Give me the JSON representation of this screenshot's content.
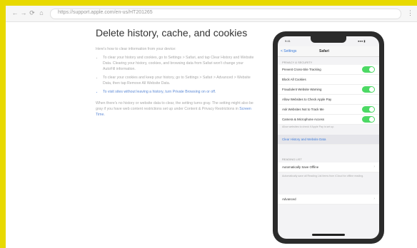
{
  "browser": {
    "back_glyph": "←",
    "forward_glyph": "→",
    "reload_glyph": "⟳",
    "home_glyph": "⌂",
    "url": "https://support.apple.com/en-us/HT201265",
    "menu_glyph": "⋮"
  },
  "article": {
    "title": "Delete history, cache, and cookies",
    "lead": "Here's how to clear information from your device:",
    "bullets": [
      "To clear your history and cookies, go to Settings > Safari, and tap Clear History and Website Data. Clearing your history, cookies, and browsing data from Safari won't change your AutoFill information.",
      "To clear your cookies and keep your history, go to Settings > Safari > Advanced > Website Data, then tap Remove All Website Data.",
      "To visit sites without leaving a history, turn Private Browsing on or off."
    ],
    "footer_text": "When there's no history or website data to clear, the setting turns gray. The setting might also be gray if you have web content restrictions set up under Content & Privacy Restrictions in",
    "footer_link": "Screen Time."
  },
  "phone": {
    "time": "9:41",
    "signal": "●●● ▮",
    "back_label": "< Settings",
    "nav_title": "Safari",
    "section_general": "PRIVACY & SECURITY",
    "settings": [
      {
        "label": "Prevent Cross-Site Tracking",
        "toggle": true
      },
      {
        "label": "Block All Cookies",
        "toggle": false
      },
      {
        "label": "Fraudulent Website Warning",
        "toggle": true
      },
      {
        "label": "Allow Websites to Check Apple Pay",
        "toggle": false
      },
      {
        "label": "Ask Websites Not to Track Me",
        "toggle": true
      },
      {
        "label": "Camera & Microphone Access",
        "toggle": true
      }
    ],
    "privacy_note": "Allow websites to check if Apple Pay is set up.",
    "clear_label": "Clear History and Website Data",
    "section_reading": "READING LIST",
    "offline_label": "Automatically Save Offline",
    "offline_note": "Automatically save all Reading List items from iCloud for offline reading.",
    "advanced_label": "Advanced",
    "chevron": "›"
  }
}
